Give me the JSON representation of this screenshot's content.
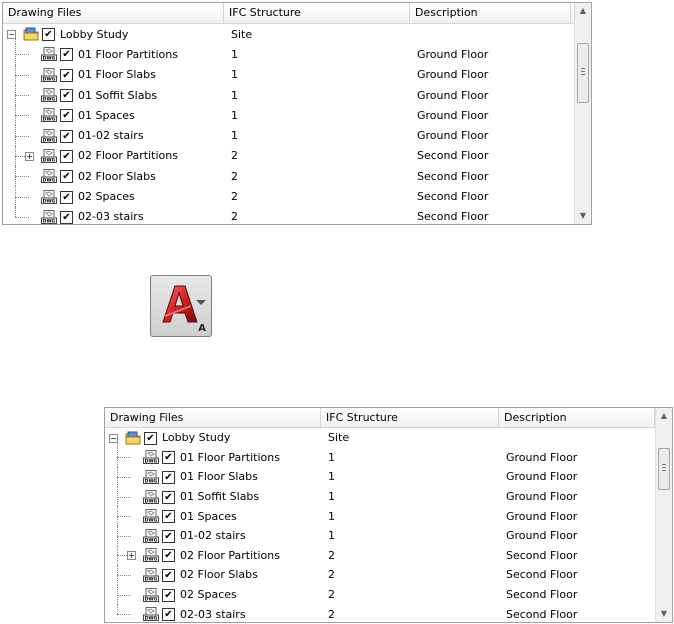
{
  "tree_top": {
    "columns": [
      {
        "label": "Drawing Files"
      },
      {
        "label": "IFC Structure"
      },
      {
        "label": "Description"
      }
    ],
    "rows": [
      {
        "name": "Lobby Study",
        "ifc": "Site",
        "desc": "",
        "level": 0,
        "expander": "minus",
        "icon": "folder",
        "checked": true
      },
      {
        "name": "01 Floor Partitions",
        "ifc": "1",
        "desc": "Ground Floor",
        "level": 1,
        "expander": "",
        "icon": "dwg",
        "checked": true
      },
      {
        "name": "01 Floor Slabs",
        "ifc": "1",
        "desc": "Ground Floor",
        "level": 1,
        "expander": "",
        "icon": "dwg",
        "checked": true
      },
      {
        "name": "01 Soffit Slabs",
        "ifc": "1",
        "desc": "Ground Floor",
        "level": 1,
        "expander": "",
        "icon": "dwg",
        "checked": true
      },
      {
        "name": "01 Spaces",
        "ifc": "1",
        "desc": "Ground Floor",
        "level": 1,
        "expander": "",
        "icon": "dwg",
        "checked": true
      },
      {
        "name": "01-02 stairs",
        "ifc": "1",
        "desc": "Ground Floor",
        "level": 1,
        "expander": "",
        "icon": "dwg",
        "checked": true
      },
      {
        "name": "02 Floor Partitions",
        "ifc": "2",
        "desc": "Second Floor",
        "level": 1,
        "expander": "plus",
        "icon": "dwg",
        "checked": true
      },
      {
        "name": "02 Floor Slabs",
        "ifc": "2",
        "desc": "Second Floor",
        "level": 1,
        "expander": "",
        "icon": "dwg",
        "checked": true
      },
      {
        "name": "02 Spaces",
        "ifc": "2",
        "desc": "Second Floor",
        "level": 1,
        "expander": "",
        "icon": "dwg",
        "checked": true
      },
      {
        "name": "02-03 stairs",
        "ifc": "2",
        "desc": "Second Floor",
        "level": 1,
        "expander": "",
        "icon": "dwg",
        "checked": true
      }
    ],
    "scroll_up_icon": "scroll-up-arrow-icon",
    "scroll_down_icon": "scroll-down-arrow-icon"
  },
  "app_button": {
    "icon": "autocad-application-icon",
    "badge": "A",
    "accent_color": "#d42020"
  },
  "tree_bottom": {
    "columns": [
      {
        "label": "Drawing Files"
      },
      {
        "label": "IFC Structure"
      },
      {
        "label": "Description"
      }
    ],
    "rows": [
      {
        "name": "Lobby Study",
        "ifc": "Site",
        "desc": "",
        "level": 0,
        "expander": "minus",
        "icon": "folder",
        "checked": true
      },
      {
        "name": "01 Floor Partitions",
        "ifc": "1",
        "desc": "Ground Floor",
        "level": 1,
        "expander": "",
        "icon": "dwg",
        "checked": true
      },
      {
        "name": "01 Floor Slabs",
        "ifc": "1",
        "desc": "Ground Floor",
        "level": 1,
        "expander": "",
        "icon": "dwg",
        "checked": true
      },
      {
        "name": "01 Soffit Slabs",
        "ifc": "1",
        "desc": "Ground Floor",
        "level": 1,
        "expander": "",
        "icon": "dwg",
        "checked": true
      },
      {
        "name": "01 Spaces",
        "ifc": "1",
        "desc": "Ground Floor",
        "level": 1,
        "expander": "",
        "icon": "dwg",
        "checked": true
      },
      {
        "name": "01-02 stairs",
        "ifc": "1",
        "desc": "Ground Floor",
        "level": 1,
        "expander": "",
        "icon": "dwg",
        "checked": true
      },
      {
        "name": "02 Floor Partitions",
        "ifc": "2",
        "desc": "Second Floor",
        "level": 1,
        "expander": "plus",
        "icon": "dwg",
        "checked": true
      },
      {
        "name": "02 Floor Slabs",
        "ifc": "2",
        "desc": "Second Floor",
        "level": 1,
        "expander": "",
        "icon": "dwg",
        "checked": true
      },
      {
        "name": "02 Spaces",
        "ifc": "2",
        "desc": "Second Floor",
        "level": 1,
        "expander": "",
        "icon": "dwg",
        "checked": true
      },
      {
        "name": "02-03 stairs",
        "ifc": "2",
        "desc": "Second Floor",
        "level": 1,
        "expander": "",
        "icon": "dwg",
        "checked": true
      }
    ],
    "scroll_up_icon": "scroll-up-arrow-icon",
    "scroll_down_icon": "scroll-down-arrow-icon"
  }
}
